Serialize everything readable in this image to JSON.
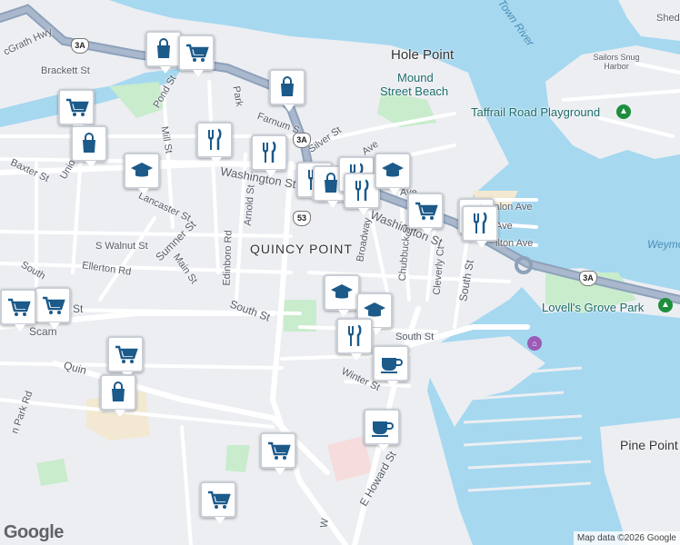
{
  "place_labels": {
    "quincy_point": "QUINCY POINT",
    "hole_point": "Hole Point",
    "pine_point": "Pine Point",
    "sailors_snug_harbor": "Sailors Snug Harbor",
    "shed": "Shed"
  },
  "poi_labels": {
    "mound_street_beach_1": "Mound",
    "mound_street_beach_2": "Street Beach",
    "taffrail": "Taffrail Road Playground",
    "lovells_grove": "Lovell's Grove Park"
  },
  "water_labels": {
    "town_river": "Town River",
    "weymouth": "Weymo"
  },
  "streets": {
    "mcgrath": "cGrath Hwy",
    "brackett": "Brackett St",
    "pond": "Pond St",
    "mill": "Mill St",
    "park": "Park",
    "farnum": "Farnum S",
    "silver": "Silver St",
    "ave": "Ave",
    "baxter": "Baxter St",
    "union": "Union",
    "washington_w": "Washington St",
    "washington_e": "Washington St",
    "lancaster": "Lancaster St",
    "arnold": "Arnold St",
    "edinboro": "Edinboro Rd",
    "sumner": "Sumner St",
    "s_walnut": "S Walnut St",
    "ellerton": "Ellerton Rd",
    "main": "Main St",
    "south_w": "South St",
    "south_s": "South",
    "scammell": "Scam",
    "scammell2": "St",
    "quincy": "Quin",
    "park_rd": "n Park Rd",
    "broadway": "Broadway",
    "chubbuck": "Chubbuck St",
    "cleverly": "Cleverly Ct",
    "south_e": "South St",
    "south_mid": "South St",
    "winter": "Winter St",
    "e_howard": "E Howard St",
    "avalon": "valon Ave",
    "ave2": "Ave",
    "hilton": "ilton Ave",
    "sa": "Sa",
    "w": "W",
    "ave3": "Ave"
  },
  "route_shields": {
    "r3a_nw": "3A",
    "r3a_mid": "3A",
    "r3a_e": "3A",
    "r53": "53"
  },
  "markers": [
    {
      "type": "shopping-bag",
      "name": "marker-shopping-bag-1"
    },
    {
      "type": "shopping-cart",
      "name": "marker-shopping-cart-1"
    },
    {
      "type": "shopping-bag",
      "name": "marker-shopping-bag-2"
    },
    {
      "type": "shopping-cart",
      "name": "marker-shopping-cart-2"
    },
    {
      "type": "shopping-bag",
      "name": "marker-shopping-bag-3"
    },
    {
      "type": "restaurant",
      "name": "marker-restaurant-1"
    },
    {
      "type": "restaurant",
      "name": "marker-restaurant-2"
    },
    {
      "type": "school",
      "name": "marker-school-1"
    },
    {
      "type": "restaurant",
      "name": "marker-restaurant-3"
    },
    {
      "type": "shopping-bag",
      "name": "marker-shopping-bag-4"
    },
    {
      "type": "restaurant",
      "name": "marker-restaurant-4"
    },
    {
      "type": "restaurant",
      "name": "marker-restaurant-5"
    },
    {
      "type": "school",
      "name": "marker-school-2"
    },
    {
      "type": "shopping-cart",
      "name": "marker-shopping-cart-3"
    },
    {
      "type": "restaurant",
      "name": "marker-restaurant-6"
    },
    {
      "type": "restaurant",
      "name": "marker-restaurant-7"
    },
    {
      "type": "school",
      "name": "marker-school-3"
    },
    {
      "type": "school",
      "name": "marker-school-4"
    },
    {
      "type": "restaurant",
      "name": "marker-restaurant-8"
    },
    {
      "type": "cafe",
      "name": "marker-cafe-1"
    },
    {
      "type": "shopping-cart",
      "name": "marker-shopping-cart-4"
    },
    {
      "type": "shopping-cart",
      "name": "marker-shopping-cart-5"
    },
    {
      "type": "shopping-cart",
      "name": "marker-shopping-cart-6"
    },
    {
      "type": "shopping-bag",
      "name": "marker-shopping-bag-5"
    },
    {
      "type": "cafe",
      "name": "marker-cafe-2"
    },
    {
      "type": "shopping-cart",
      "name": "marker-shopping-cart-7"
    },
    {
      "type": "shopping-cart",
      "name": "marker-shopping-cart-8"
    }
  ],
  "colors": {
    "water": "#a6d8f0",
    "land": "#eceef2",
    "park": "#c8eccc",
    "highway": "#8ea1ba",
    "road": "#ffffff",
    "marker_icon": "#1c5a8a"
  },
  "footer": {
    "logo": "Google",
    "attribution": "Map data ©2026 Google"
  }
}
